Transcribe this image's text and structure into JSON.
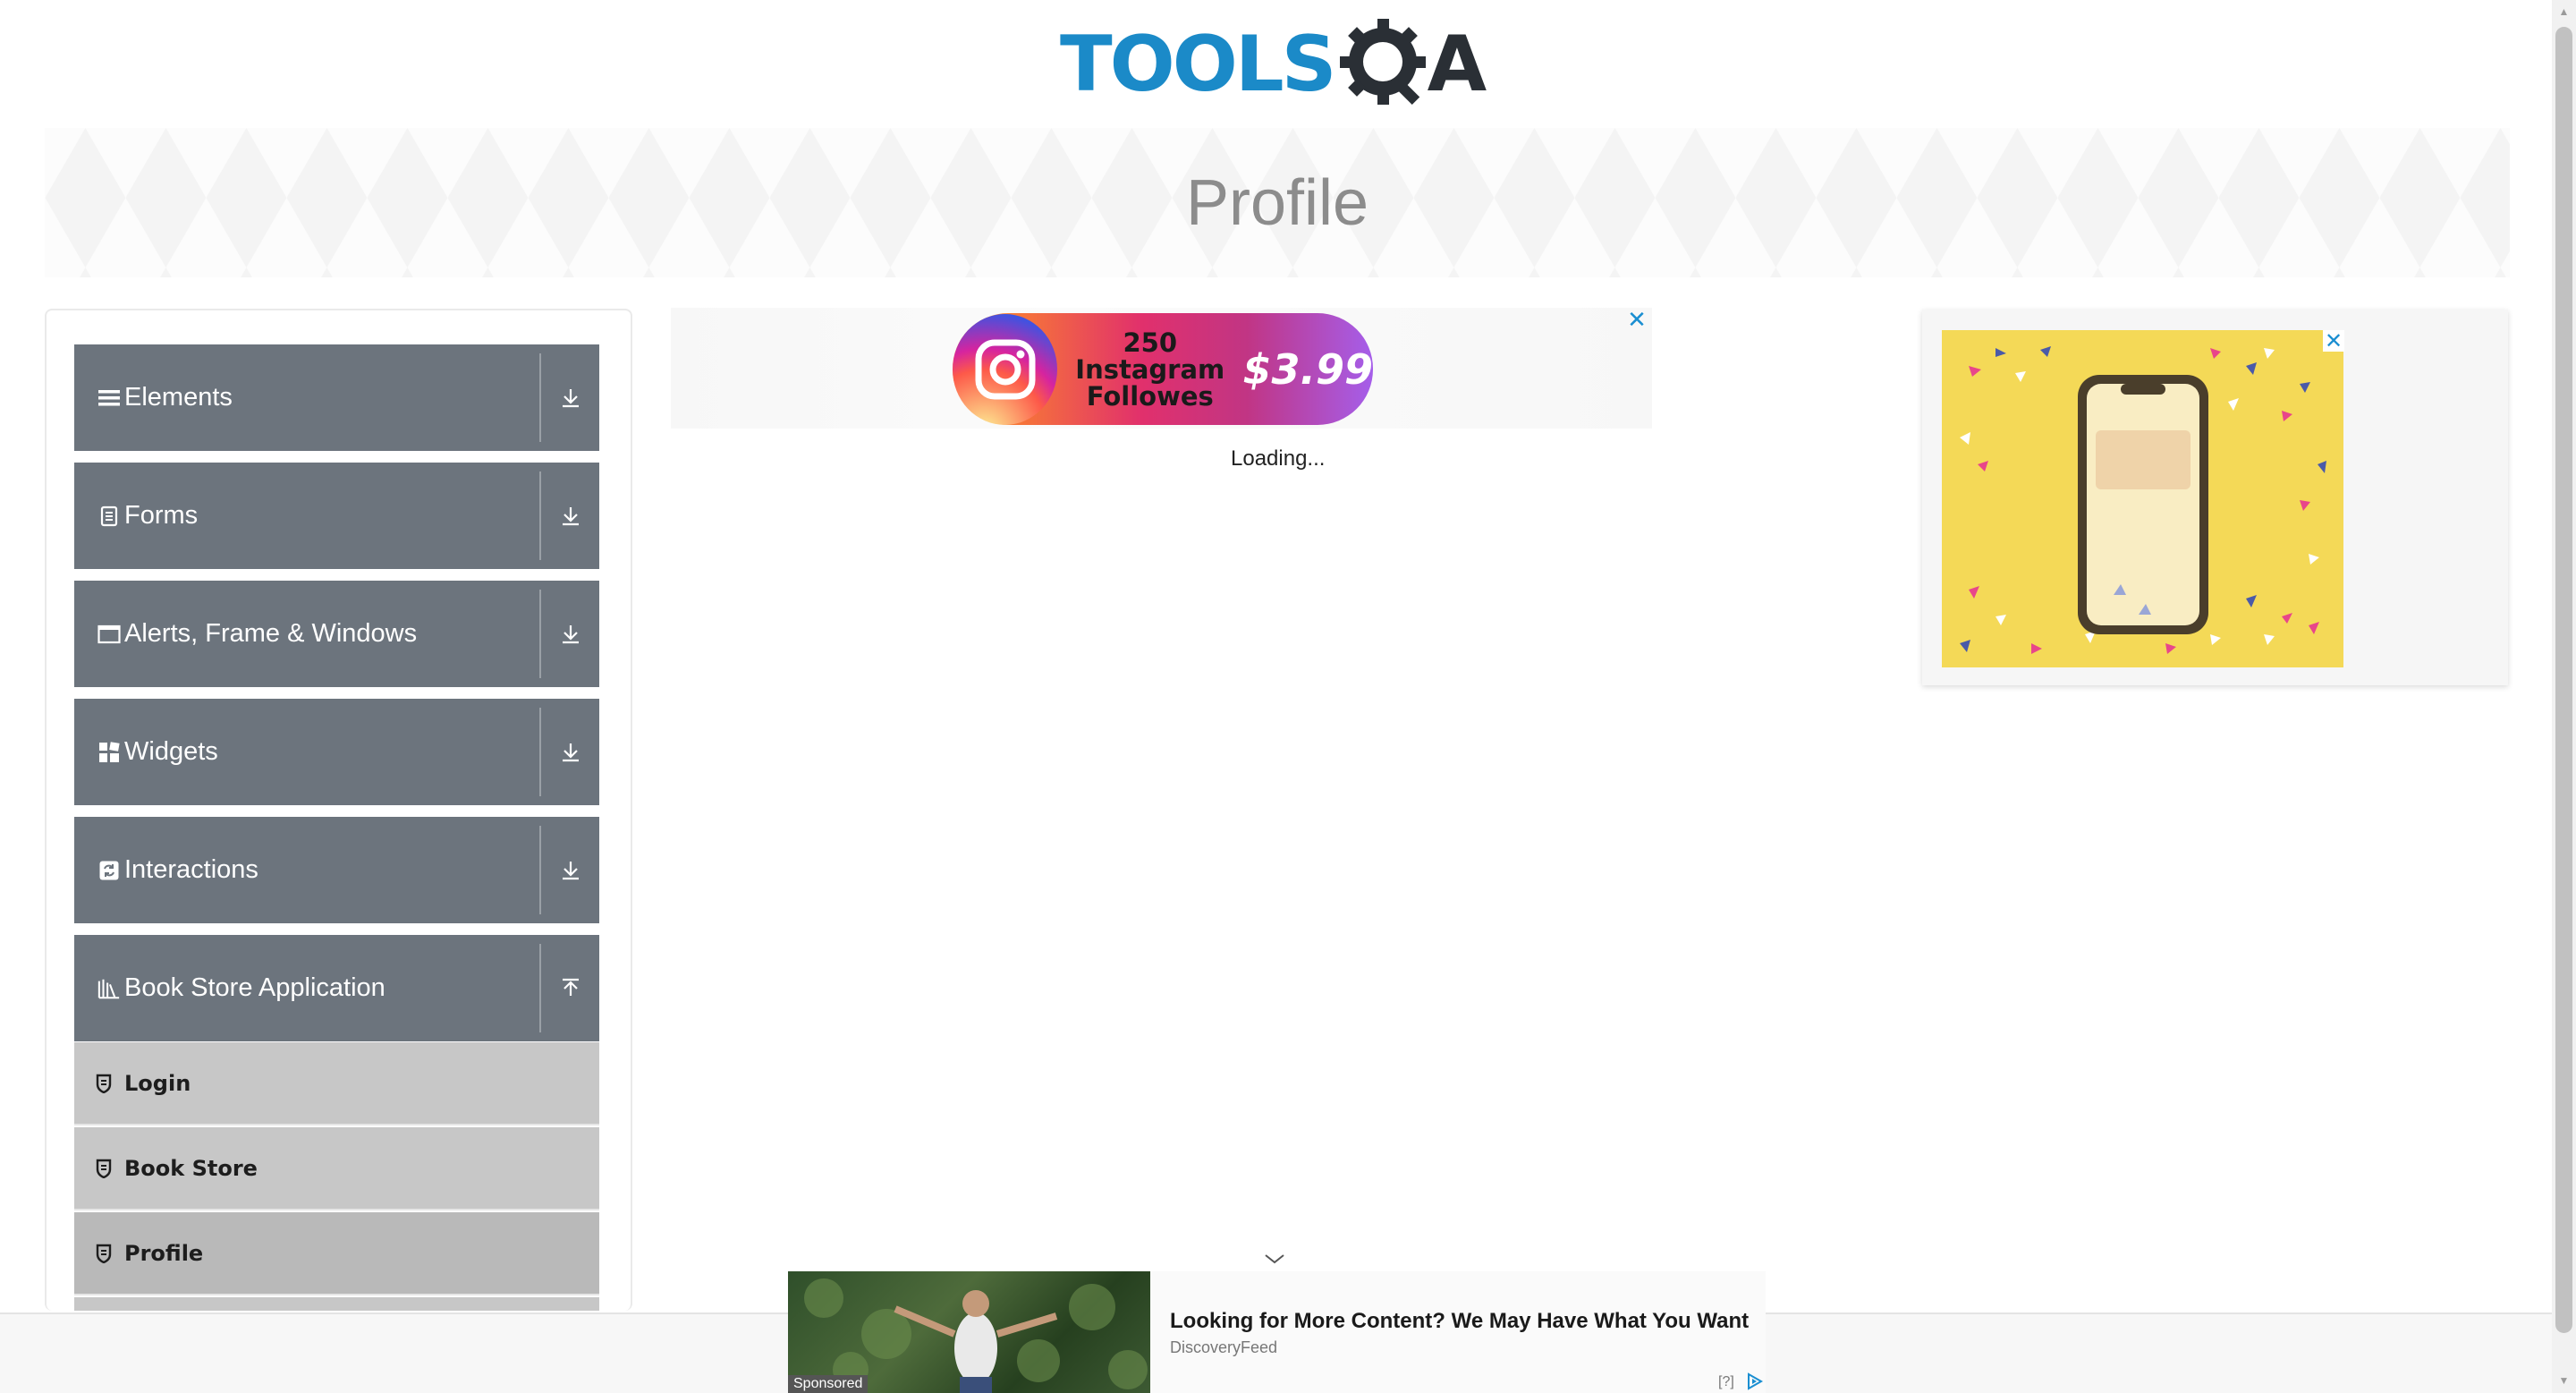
{
  "header": {
    "logo_text": "TOOLS",
    "logo_suffix": "A"
  },
  "banner": {
    "title": "Profile"
  },
  "sidebar": {
    "groups": [
      {
        "label": "Elements",
        "icon": "hamburger-icon",
        "expanded": false
      },
      {
        "label": "Forms",
        "icon": "document-icon",
        "expanded": false
      },
      {
        "label": "Alerts, Frame & Windows",
        "icon": "window-icon",
        "expanded": false
      },
      {
        "label": "Widgets",
        "icon": "grid-icon",
        "expanded": false
      },
      {
        "label": "Interactions",
        "icon": "refresh-icon",
        "expanded": false
      },
      {
        "label": "Book Store Application",
        "icon": "books-icon",
        "expanded": true
      }
    ],
    "subitems": [
      {
        "label": "Login",
        "icon": "shield-icon"
      },
      {
        "label": "Book Store",
        "icon": "shield-icon"
      },
      {
        "label": "Profile",
        "icon": "shield-icon",
        "active": true
      }
    ]
  },
  "center_ad": {
    "promo_line1": "250 Instagram",
    "promo_line2": "Followes",
    "price": "$3.99",
    "close": "✕",
    "loading": "Loading..."
  },
  "right_ad": {
    "close": "✕"
  },
  "bottom_ad": {
    "sponsored": "Sponsored",
    "headline": "Looking for More Content? We May Have What You Want",
    "source": "DiscoveryFeed",
    "question": "[?]"
  },
  "colors": {
    "accent": "#1b8ac8",
    "sidebar_group": "#6c747d",
    "sidebar_subitem": "#c7c7c7",
    "ad_close": "#1a8ed1"
  }
}
